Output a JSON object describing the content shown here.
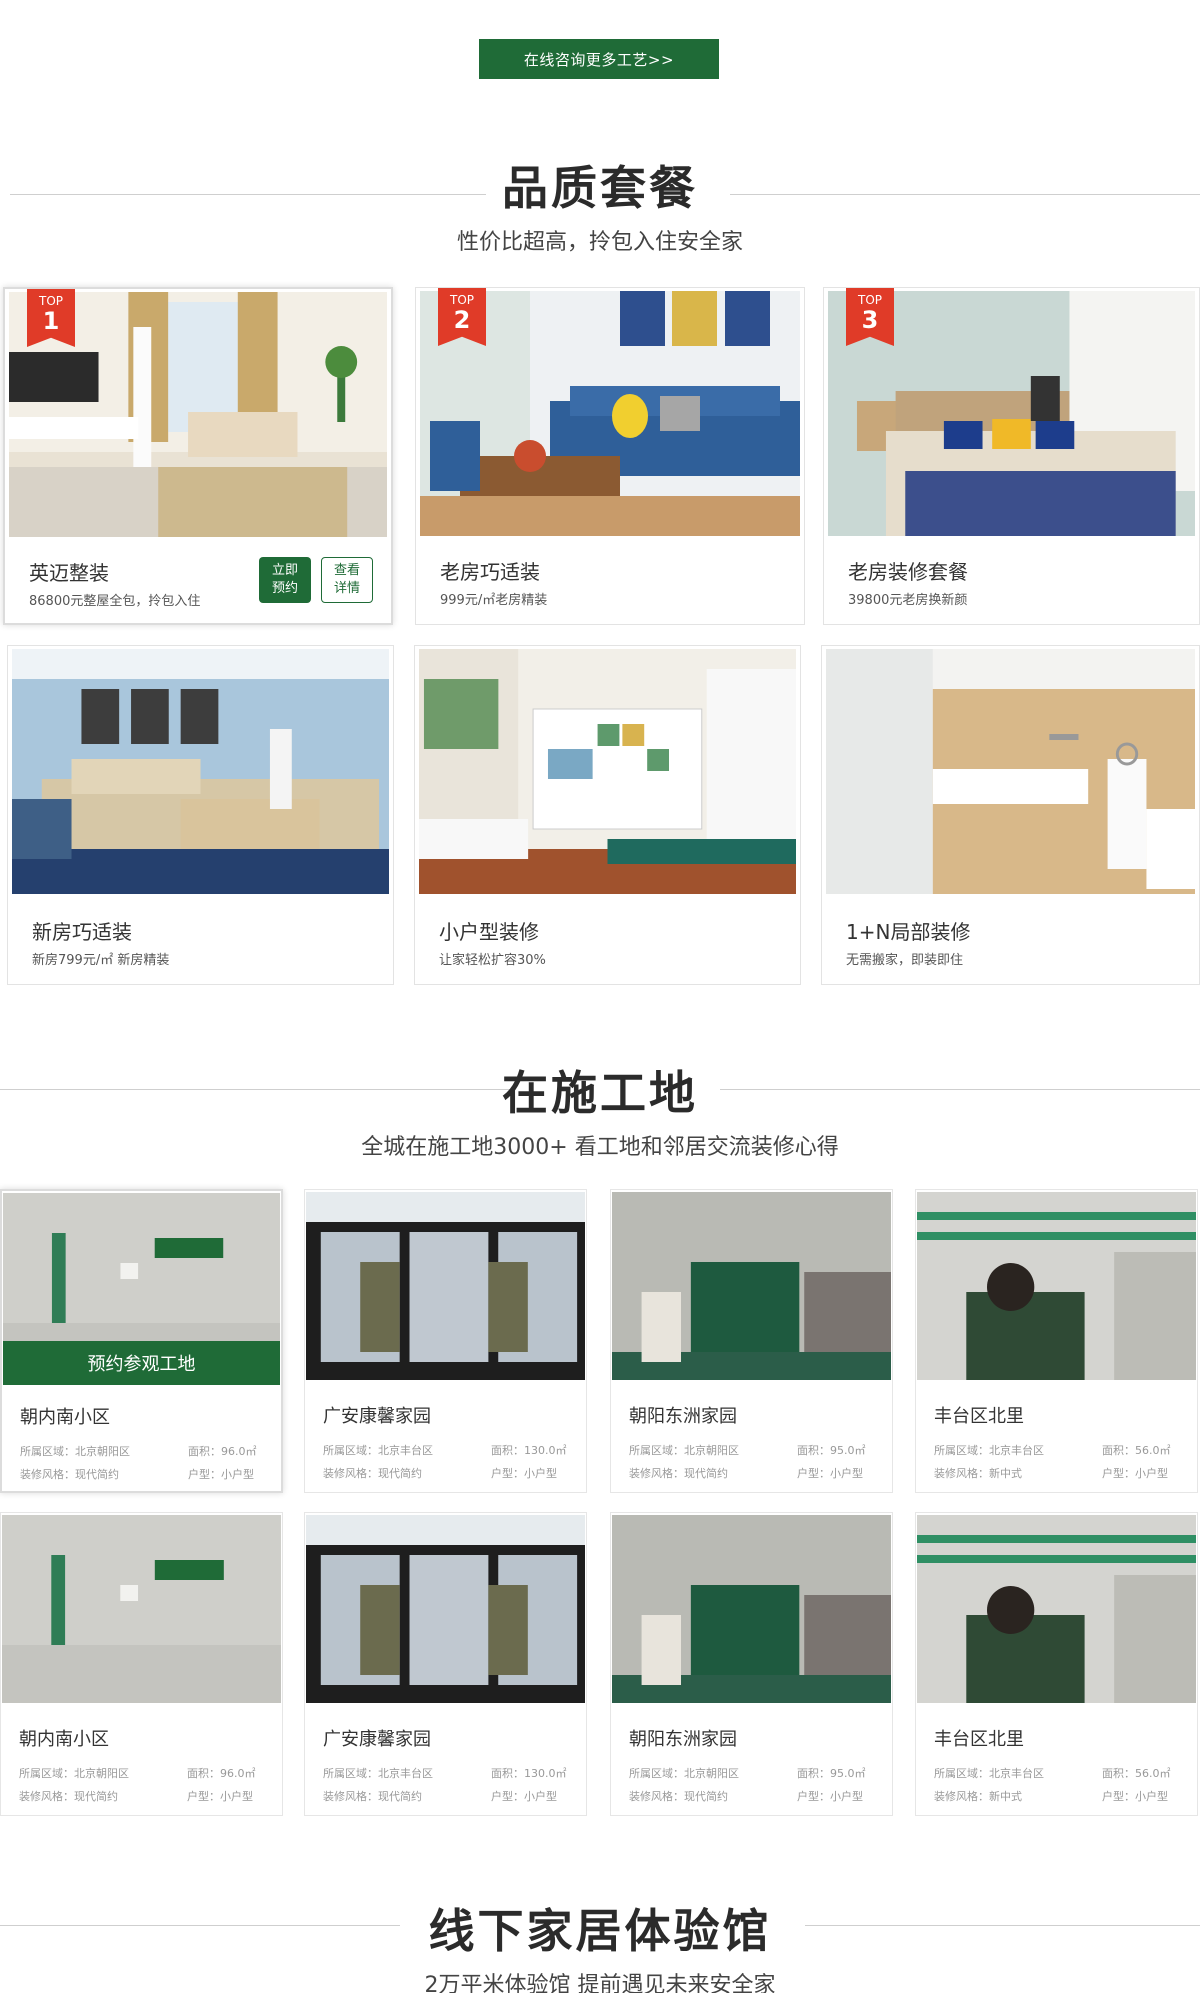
{
  "consult_button": "在线咨询更多工艺>>",
  "quality": {
    "title": "品质套餐",
    "subtitle": "性价比超高，拎包入住安全家"
  },
  "packages": [
    {
      "badge_top": "TOP",
      "badge_num": "1",
      "name": "英迈整装",
      "desc": "86800元整屋全包，拎包入住",
      "btn_book": "立即\n预约",
      "btn_detail": "查看\n详情"
    },
    {
      "badge_top": "TOP",
      "badge_num": "2",
      "name": "老房巧适装",
      "desc": "999元/㎡老房精装"
    },
    {
      "badge_top": "TOP",
      "badge_num": "3",
      "name": "老房装修套餐",
      "desc": "39800元老房换新颜"
    },
    {
      "name": "新房巧适装",
      "desc": "新房799元/㎡ 新房精装"
    },
    {
      "name": "小户型装修",
      "desc": "让家轻松扩容30%"
    },
    {
      "name": "1+N局部装修",
      "desc": "无需搬家，即装即住"
    }
  ],
  "sites_section": {
    "title": "在施工地",
    "subtitle": "全城在施工地3000+ 看工地和邻居交流装修心得",
    "book_label": "预约参观工地"
  },
  "sites": [
    {
      "name": "朝内南小区",
      "area": "所属区域：北京朝阳区",
      "style": "装修风格：现代简约",
      "size": "面积：96.0㎡",
      "type": "户型：小户型"
    },
    {
      "name": "广安康馨家园",
      "area": "所属区域：北京丰台区",
      "style": "装修风格：现代简约",
      "size": "面积：130.0㎡",
      "type": "户型：小户型"
    },
    {
      "name": "朝阳东洲家园",
      "area": "所属区域：北京朝阳区",
      "style": "装修风格：现代简约",
      "size": "面积：95.0㎡",
      "type": "户型：小户型"
    },
    {
      "name": "丰台区北里",
      "area": "所属区域：北京丰台区",
      "style": "装修风格：新中式",
      "size": "面积：56.0㎡",
      "type": "户型：小户型"
    },
    {
      "name": "朝内南小区",
      "area": "所属区域：北京朝阳区",
      "style": "装修风格：现代简约",
      "size": "面积：96.0㎡",
      "type": "户型：小户型"
    },
    {
      "name": "广安康馨家园",
      "area": "所属区域：北京丰台区",
      "style": "装修风格：现代简约",
      "size": "面积：130.0㎡",
      "type": "户型：小户型"
    },
    {
      "name": "朝阳东洲家园",
      "area": "所属区域：北京朝阳区",
      "style": "装修风格：现代简约",
      "size": "面积：95.0㎡",
      "type": "户型：小户型"
    },
    {
      "name": "丰台区北里",
      "area": "所属区域：北京丰台区",
      "style": "装修风格：新中式",
      "size": "面积：56.0㎡",
      "type": "户型：小户型"
    }
  ],
  "experience": {
    "title": "线下家居体验馆",
    "subtitle": "2万平米体验馆 提前遇见未来安全家"
  },
  "colors": {
    "brand_green": "#1f6b37",
    "badge_red": "#e03b28"
  }
}
